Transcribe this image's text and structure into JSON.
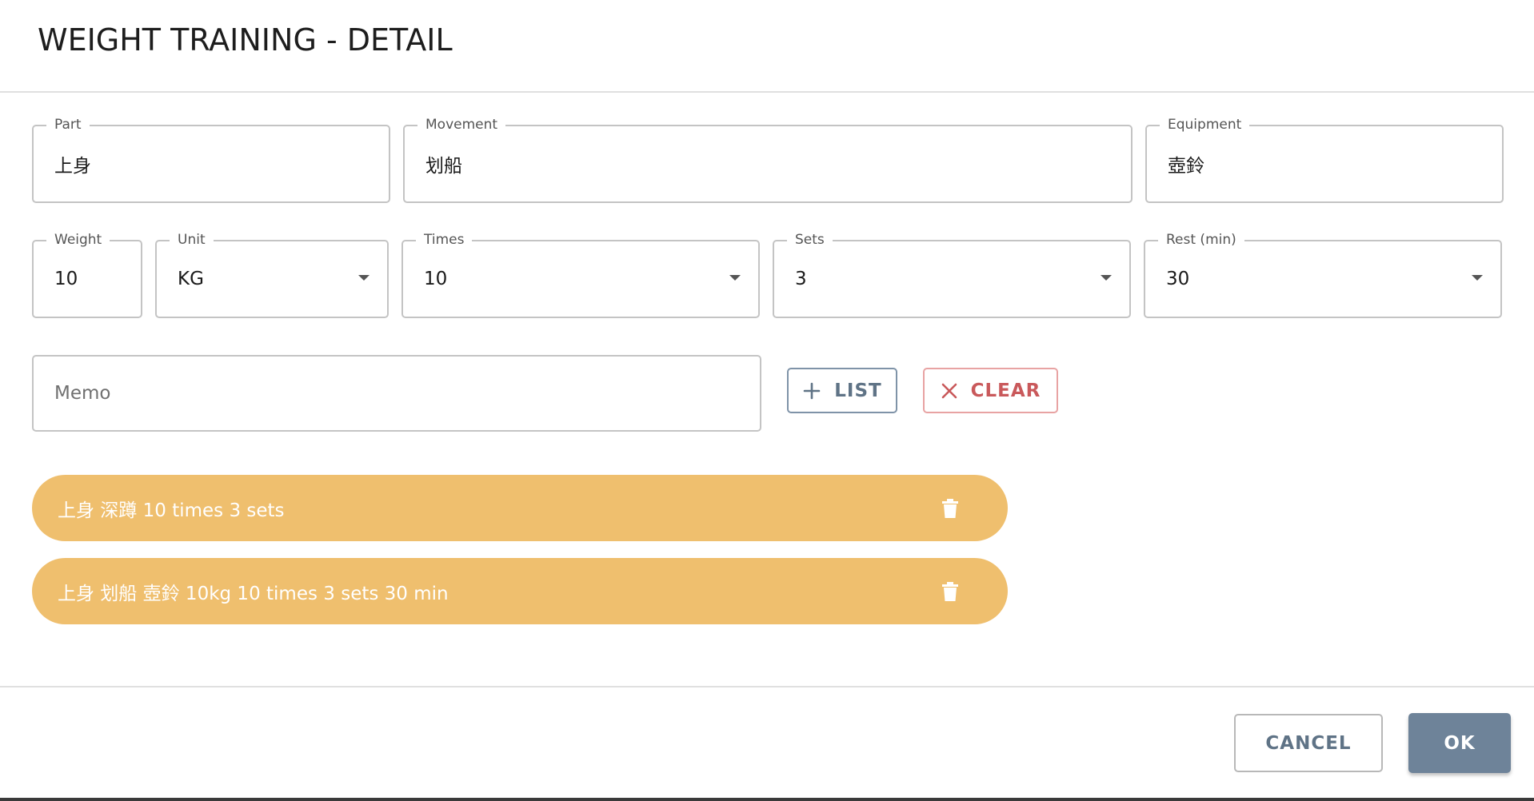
{
  "dialog": {
    "title": "WEIGHT TRAINING - DETAIL"
  },
  "fields": {
    "part": {
      "label": "Part",
      "value": "上身"
    },
    "movement": {
      "label": "Movement",
      "value": "划船"
    },
    "equipment": {
      "label": "Equipment",
      "value": "壺鈴"
    },
    "weight": {
      "label": "Weight",
      "value": "10"
    },
    "unit": {
      "label": "Unit",
      "value": "KG"
    },
    "times": {
      "label": "Times",
      "value": "10"
    },
    "sets": {
      "label": "Sets",
      "value": "3"
    },
    "rest": {
      "label": "Rest (min)",
      "value": "30"
    },
    "memo": {
      "placeholder": "Memo",
      "value": ""
    }
  },
  "actions": {
    "list_label": "LIST",
    "clear_label": "CLEAR",
    "list_icon": "plus-icon",
    "clear_icon": "close-icon"
  },
  "entries": [
    {
      "label": "上身 深蹲 10 times 3 sets",
      "icon": "trash-icon"
    },
    {
      "label": "上身 划船 壺鈴 10kg 10 times 3 sets 30 min",
      "icon": "trash-icon"
    }
  ],
  "footer": {
    "cancel_label": "CANCEL",
    "ok_label": "OK"
  },
  "colors": {
    "chip": "#efbf6e",
    "primary": "#6e8399",
    "list_button": "#5f7386",
    "clear_button": "#c9595b"
  }
}
